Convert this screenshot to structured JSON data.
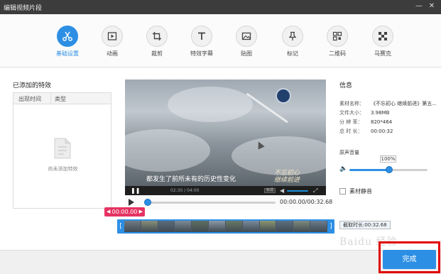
{
  "window": {
    "title": "编辑视频片段",
    "minimize": "—",
    "close": "✕"
  },
  "toolbar": [
    {
      "label": "基础设置",
      "icon": "scissors-icon",
      "active": true
    },
    {
      "label": "动画",
      "icon": "play-frame-icon",
      "active": false
    },
    {
      "label": "裁剪",
      "icon": "crop-icon",
      "active": false
    },
    {
      "label": "特效字幕",
      "icon": "text-t-icon",
      "active": false
    },
    {
      "label": "贴图",
      "icon": "image-icon",
      "active": false
    },
    {
      "label": "标记",
      "icon": "pin-icon",
      "active": false
    },
    {
      "label": "二维码",
      "icon": "qrcode-icon",
      "active": false
    },
    {
      "label": "马赛克",
      "icon": "mosaic-icon",
      "active": false
    }
  ],
  "effects": {
    "title": "已添加的特效",
    "columns": [
      "出现时间",
      "类型"
    ],
    "empty_text": "尚未添加特效"
  },
  "player": {
    "subtitle": "都发生了前所未有的历史性变化",
    "calligraphy": "不忘初心\n继续前进",
    "inner_time": "02:30 / 04:00",
    "inner_mode": "标清",
    "time": "00:00.00/00:32.68",
    "progress": 0
  },
  "timeline": {
    "marker": "00:00.00",
    "frame_count": 12
  },
  "info": {
    "title": "信息",
    "rows": [
      {
        "key": "素材名称：",
        "value": "《不忘初心 继续前进》第五..."
      },
      {
        "key": "文件大小：",
        "value": "3.98MB"
      },
      {
        "key": "分 辨 率：",
        "value": "820*464"
      },
      {
        "key": "总 时 长：",
        "value": "00:00:32"
      }
    ],
    "volume_title": "原声音量",
    "volume_value": "100%",
    "volume_level": 0.5,
    "mute_label": "素材静音",
    "clip_length": "截取时长:00:32.68"
  },
  "footer": {
    "done_label": "完成",
    "watermark": "Baidu 经验"
  },
  "colors": {
    "accent": "#2d8fe4",
    "marker": "#e53363",
    "highlight": "#e00000"
  }
}
